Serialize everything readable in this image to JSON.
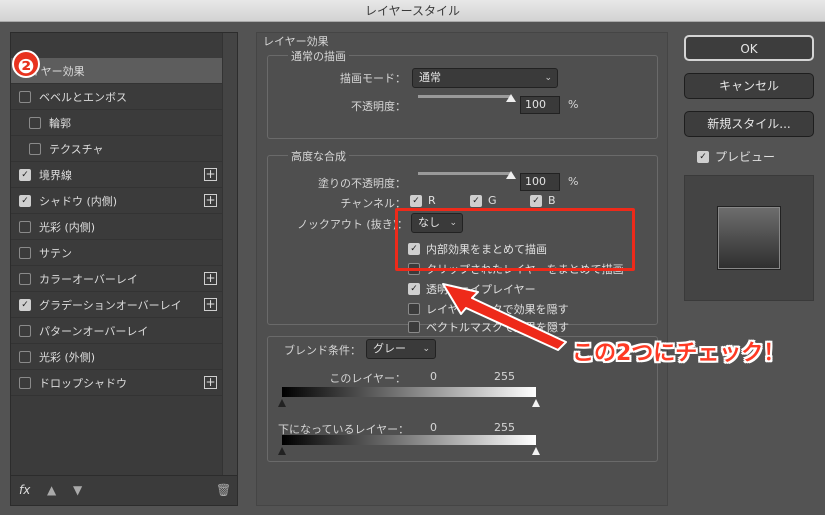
{
  "window": {
    "title": "レイヤースタイル"
  },
  "step_badge": "❷",
  "style_list": {
    "items": [
      {
        "label": "レイヤー効果",
        "checkbox": false,
        "checked": false,
        "plus": false,
        "selected": true,
        "indent": false
      },
      {
        "label": "ベベルとエンボス",
        "checkbox": true,
        "checked": false,
        "plus": false,
        "selected": false,
        "indent": false
      },
      {
        "label": "輪郭",
        "checkbox": true,
        "checked": false,
        "plus": false,
        "selected": false,
        "indent": true
      },
      {
        "label": "テクスチャ",
        "checkbox": true,
        "checked": false,
        "plus": false,
        "selected": false,
        "indent": true
      },
      {
        "label": "境界線",
        "checkbox": true,
        "checked": true,
        "plus": true,
        "selected": false,
        "indent": false
      },
      {
        "label": "シャドウ (内側)",
        "checkbox": true,
        "checked": true,
        "plus": true,
        "selected": false,
        "indent": false
      },
      {
        "label": "光彩 (内側)",
        "checkbox": true,
        "checked": false,
        "plus": false,
        "selected": false,
        "indent": false
      },
      {
        "label": "サテン",
        "checkbox": true,
        "checked": false,
        "plus": false,
        "selected": false,
        "indent": false
      },
      {
        "label": "カラーオーバーレイ",
        "checkbox": true,
        "checked": false,
        "plus": true,
        "selected": false,
        "indent": false
      },
      {
        "label": "グラデーションオーバーレイ",
        "checkbox": true,
        "checked": true,
        "plus": true,
        "selected": false,
        "indent": false
      },
      {
        "label": "パターンオーバーレイ",
        "checkbox": true,
        "checked": false,
        "plus": false,
        "selected": false,
        "indent": false
      },
      {
        "label": "光彩 (外側)",
        "checkbox": true,
        "checked": false,
        "plus": false,
        "selected": false,
        "indent": false
      },
      {
        "label": "ドロップシャドウ",
        "checkbox": true,
        "checked": false,
        "plus": true,
        "selected": false,
        "indent": false
      }
    ],
    "footer": {
      "fx": "fx",
      "up": "▲",
      "down": "▼",
      "trash": "🗑"
    }
  },
  "panel": {
    "title": "レイヤー効果",
    "general_blending": {
      "title": "通常の描画",
      "blend_mode_label": "描画モード：",
      "blend_mode_value": "通常",
      "opacity_label": "不透明度：",
      "opacity_value": "100",
      "opacity_unit": "%"
    },
    "advanced_blending": {
      "title": "高度な合成",
      "fill_opacity_label": "塗りの不透明度：",
      "fill_opacity_value": "100",
      "fill_opacity_unit": "%",
      "channels_label": "チャンネル：",
      "channels": [
        {
          "name": "R",
          "checked": true
        },
        {
          "name": "G",
          "checked": true
        },
        {
          "name": "B",
          "checked": true
        }
      ],
      "knockout_label": "ノックアウト (抜き)：",
      "knockout_value": "なし",
      "options": [
        {
          "label": "内部効果をまとめて描画",
          "checked": true
        },
        {
          "label": "クリップされたレイヤーをまとめて描画",
          "checked": false
        },
        {
          "label": "透明シェイプレイヤー",
          "checked": true
        },
        {
          "label": "レイヤーマスクで効果を隠す",
          "checked": false
        },
        {
          "label": "ベクトルマスクで効果を隠す",
          "checked": false
        }
      ]
    },
    "blend_if": {
      "label": "ブレンド条件：",
      "value": "グレー",
      "this_layer_label": "このレイヤー：",
      "this_layer_min": "0",
      "this_layer_max": "255",
      "underlying_label": "下になっているレイヤー：",
      "underlying_min": "0",
      "underlying_max": "255"
    }
  },
  "buttons": {
    "ok": "OK",
    "cancel": "キャンセル",
    "new_style": "新規スタイル...",
    "preview_label": "プレビュー",
    "preview_checked": true
  },
  "annotation": {
    "callout_text": "この2つにチェック！",
    "color": "#ee2a1a"
  }
}
